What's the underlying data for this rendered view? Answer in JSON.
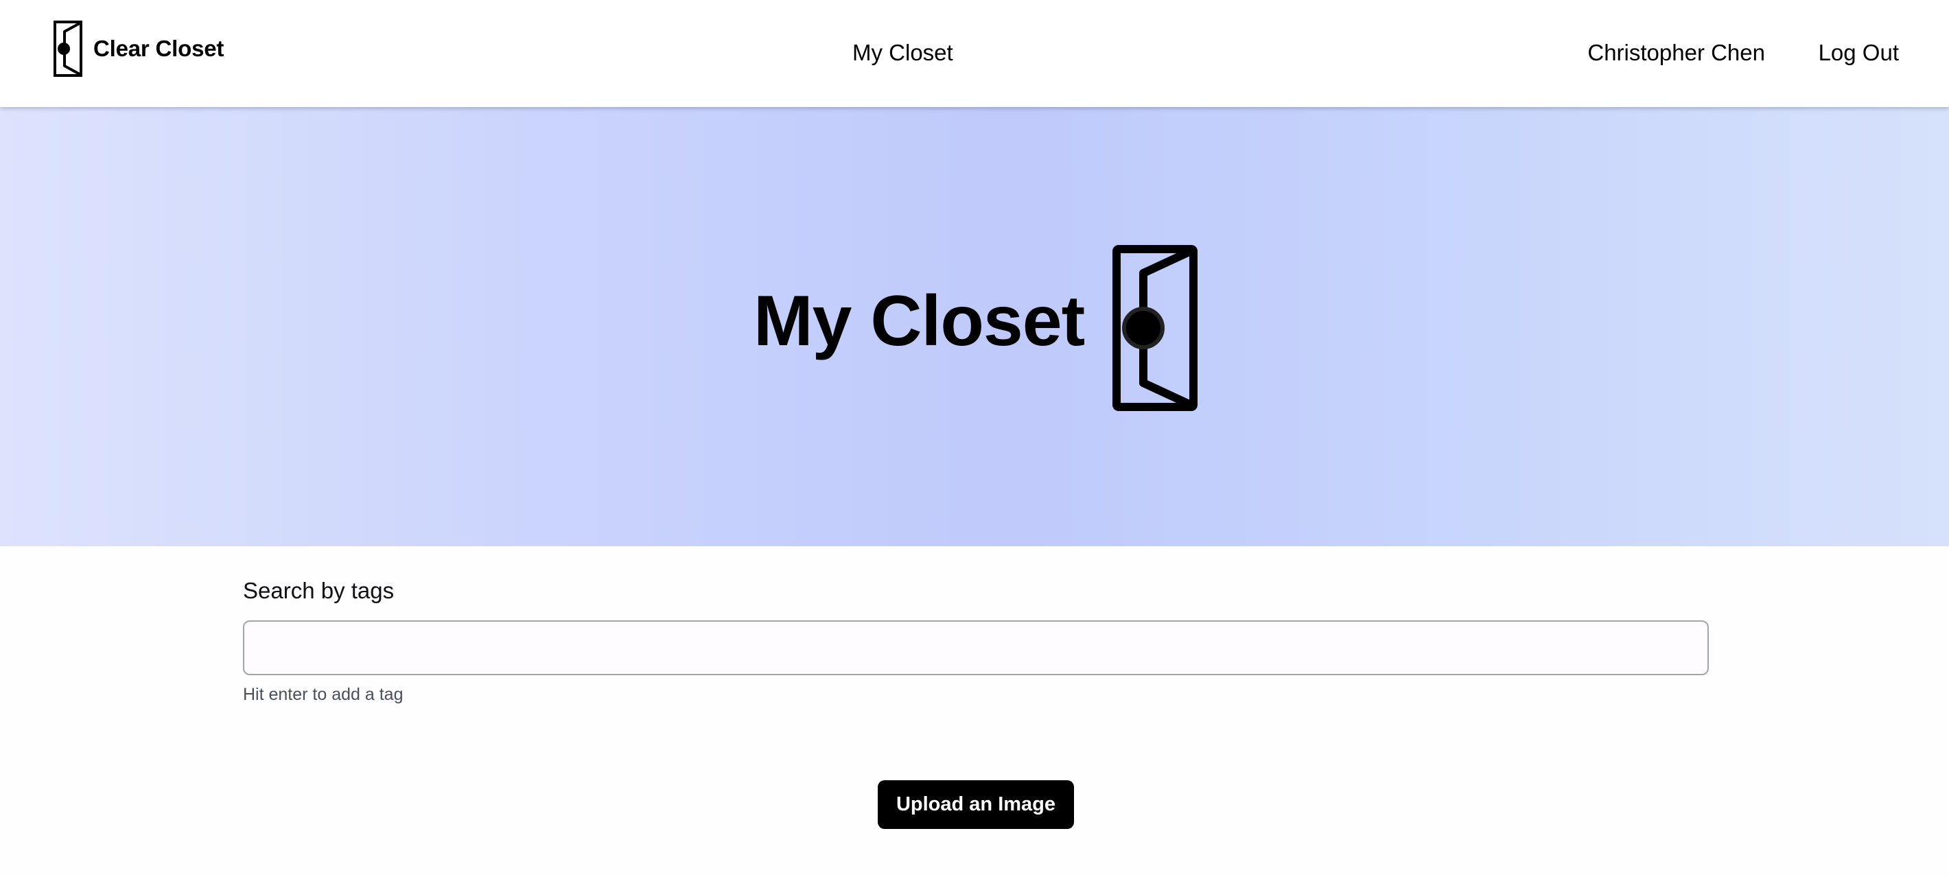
{
  "header": {
    "brand_name": "Clear Closet",
    "brand_icon": "closet-door-icon",
    "nav_center": "My Closet",
    "user_name": "Christopher Chen",
    "logout_label": "Log Out"
  },
  "hero": {
    "title": "My Closet",
    "icon": "closet-door-icon"
  },
  "search": {
    "label": "Search by tags",
    "value": "",
    "placeholder": "",
    "hint": "Hit enter to add a tag"
  },
  "upload": {
    "label": "Upload an Image"
  }
}
